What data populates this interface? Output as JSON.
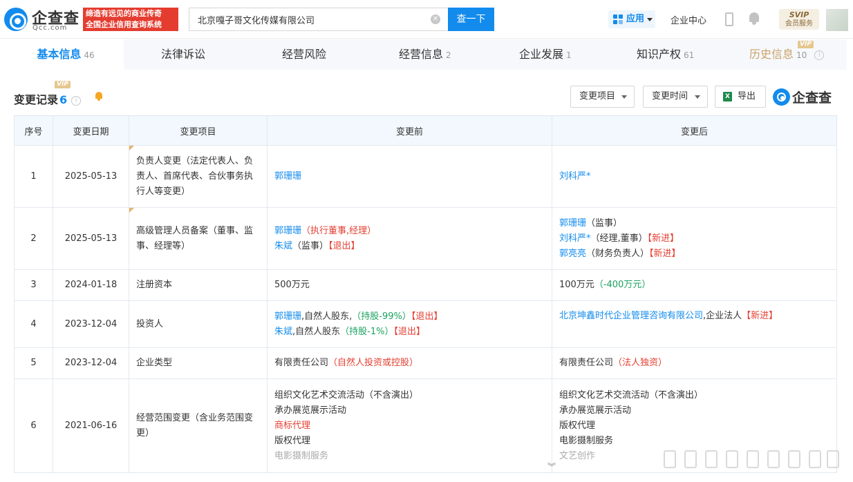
{
  "header": {
    "logo_text": "企查查",
    "logo_domain": "Qcc.com",
    "slogan_line1": "缔造有远见的商业传奇",
    "slogan_line2": "全国企业信用查询系统",
    "search_value": "北京嘎子哥文化传媒有限公司",
    "search_button": "查一下",
    "app_button": "应用",
    "enterprise_center": "企业中心",
    "svip_label": "SVIP",
    "svip_sub": "会员服务"
  },
  "tabs": [
    {
      "label": "基本信息",
      "count": "46"
    },
    {
      "label": "法律诉讼",
      "count": ""
    },
    {
      "label": "经营风险",
      "count": ""
    },
    {
      "label": "经营信息",
      "count": "2"
    },
    {
      "label": "企业发展",
      "count": "1"
    },
    {
      "label": "知识产权",
      "count": "61"
    },
    {
      "label": "历史信息",
      "count": "10"
    }
  ],
  "vip_tag": "VIP",
  "section": {
    "title": "变更记录",
    "count": "6",
    "filter_item": "变更项目",
    "filter_time": "变更时间",
    "export": "导出",
    "brand": "企查查"
  },
  "table": {
    "headers": [
      "序号",
      "变更日期",
      "变更项目",
      "变更前",
      "变更后"
    ],
    "rows": [
      {
        "idx": "1",
        "date": "2025-05-13",
        "item": "负责人变更（法定代表人、负责人、首席代表、合伙事务执行人等变更）",
        "before": [
          {
            "t": "郭珊珊",
            "c": "blue"
          }
        ],
        "after": [
          {
            "t": "刘科严*",
            "c": "blue"
          }
        ]
      },
      {
        "idx": "2",
        "date": "2025-05-13",
        "item": "高级管理人员备案（董事、监事、经理等）",
        "before_lines": [
          [
            {
              "t": "郭珊珊",
              "c": "blue"
            },
            {
              "t": "（执行董事,经理）",
              "c": "red"
            }
          ],
          [
            {
              "t": "朱斌",
              "c": "blue"
            },
            {
              "t": "（监事）",
              "c": ""
            },
            {
              "t": "【退出】",
              "c": "red"
            }
          ]
        ],
        "after_lines": [
          [
            {
              "t": "郭珊珊",
              "c": "blue"
            },
            {
              "t": "（监事）",
              "c": ""
            }
          ],
          [
            {
              "t": "刘科严*",
              "c": "blue"
            },
            {
              "t": "（经理,董事）",
              "c": ""
            },
            {
              "t": "【新进】",
              "c": "red"
            }
          ],
          [
            {
              "t": "郭亮亮",
              "c": "blue"
            },
            {
              "t": "（财务负责人）",
              "c": ""
            },
            {
              "t": "【新进】",
              "c": "red"
            }
          ]
        ]
      },
      {
        "idx": "3",
        "date": "2024-01-18",
        "item": "注册资本",
        "before_text": "500万元",
        "after_text": "100万元",
        "after_note": "（-400万元）"
      },
      {
        "idx": "4",
        "date": "2023-12-04",
        "item": "投资人",
        "before_l1_name": "郭珊珊",
        "before_l1_type": ",自然人股东,",
        "before_l1_share": "（持股-99%）",
        "before_l1_tag": "【退出】",
        "before_l2_name": "朱斌",
        "before_l2_type": ",自然人股东",
        "before_l2_share": "（持股-1%）",
        "before_l2_tag": "【退出】",
        "after_name": "北京坤鑫时代企业管理咨询有限公司",
        "after_type": ",企业法人",
        "after_tag": "【新进】"
      },
      {
        "idx": "5",
        "date": "2023-12-04",
        "item": "企业类型",
        "before_text": "有限责任公司",
        "before_note": "（自然人投资或控股）",
        "after_text": "有限责任公司",
        "after_note": "（法人独资）"
      },
      {
        "idx": "6",
        "date": "2021-06-16",
        "item": "经营范围变更（含业务范围变更）",
        "before_l1": "组织文化艺术交流活动（不含演出）",
        "before_l2": "承办展览展示活动",
        "before_l3": "商标代理",
        "before_l4": "版权代理",
        "before_l5": "电影摄制服务",
        "after_l1": "组织文化艺术交流活动（不含演出）",
        "after_l2": "承办展览展示活动",
        "after_l3": "版权代理",
        "after_l4": "电影摄制服务",
        "after_l5": "文艺创作"
      }
    ]
  },
  "colors": {
    "accent": "#128bed",
    "red": "#e53e30",
    "green": "#1aa15f",
    "vip_gold": "#c9a36a"
  }
}
